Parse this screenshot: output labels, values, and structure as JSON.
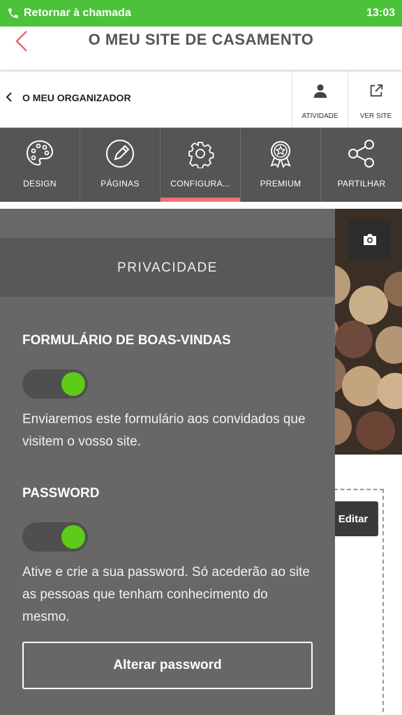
{
  "call_bar": {
    "label": "Retornar à chamada",
    "time": "13:03",
    "color": "#4cc23a"
  },
  "header": {
    "title": "O MEU SITE DE CASAMENTO"
  },
  "organizer": {
    "label": "O MEU ORGANIZADOR",
    "actions": [
      {
        "label": "ATIVIDADE",
        "icon": "person-icon"
      },
      {
        "label": "VER SITE",
        "icon": "external-link-icon"
      }
    ]
  },
  "tabs": [
    {
      "label": "DESIGN",
      "icon": "palette-icon"
    },
    {
      "label": "PÁGINAS",
      "icon": "pencil-icon"
    },
    {
      "label": "CONFIGURA...",
      "icon": "gear-icon",
      "active": true
    },
    {
      "label": "PREMIUM",
      "icon": "award-icon"
    },
    {
      "label": "PARTILHAR",
      "icon": "share-icon"
    }
  ],
  "accent_color": "#f0707a",
  "panel": {
    "section_title": "PRIVACIDADE",
    "welcome_form": {
      "heading": "FORMULÁRIO DE BOAS-VINDAS",
      "enabled": true,
      "description": "Enviaremos este formulário aos convidados que visitem o vosso site."
    },
    "password": {
      "heading": "PASSWORD",
      "enabled": true,
      "description": "Ative e crie a sua password. Só acederão ao site as pessoas que tenham conhecimento do mesmo.",
      "button_label": "Alterar password"
    },
    "toggle_color": "#5ccc16"
  },
  "preview": {
    "edit_label": "Editar",
    "camera_icon": "camera-icon"
  }
}
